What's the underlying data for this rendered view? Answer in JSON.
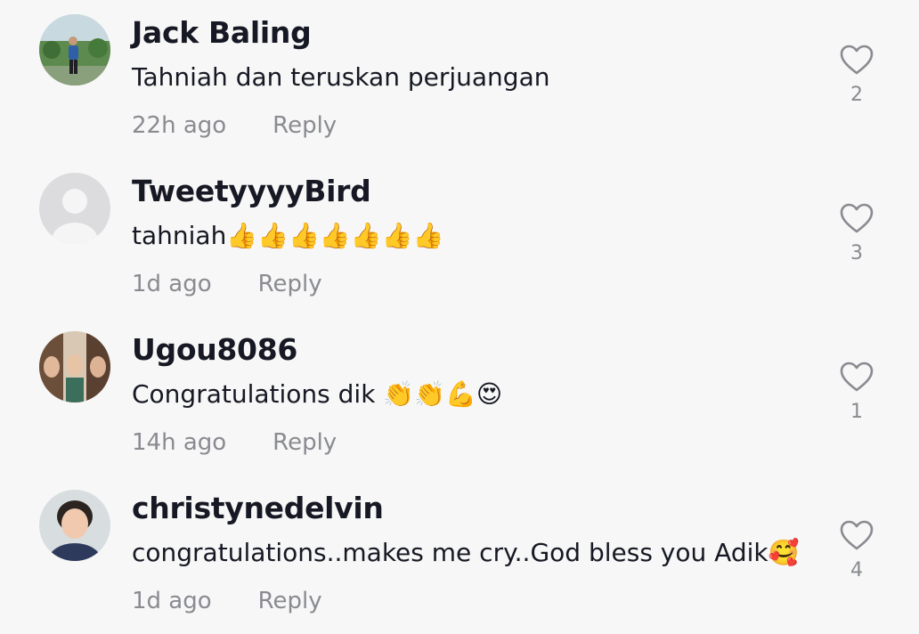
{
  "comments": [
    {
      "username": "Jack Baling",
      "text": "Tahniah dan teruskan perjuangan",
      "time": "22h ago",
      "reply": "Reply",
      "likes": "2"
    },
    {
      "username": "TweetyyyyBird",
      "text": "tahniah👍👍👍👍👍👍👍",
      "time": "1d ago",
      "reply": "Reply",
      "likes": "3"
    },
    {
      "username": "Ugou8086",
      "text": "Congratulations dik 👏👏💪😍",
      "time": "14h ago",
      "reply": "Reply",
      "likes": "1"
    },
    {
      "username": "christynedelvin",
      "text": "congratulations..makes me cry..God bless you Adik🥰",
      "time": "1d ago",
      "reply": "Reply",
      "likes": "4"
    }
  ],
  "icons": {
    "like": "heart-outline-icon"
  },
  "colors": {
    "background": "#f7f7f7",
    "primary_text": "#161823",
    "secondary_text": "#8a8b91"
  }
}
